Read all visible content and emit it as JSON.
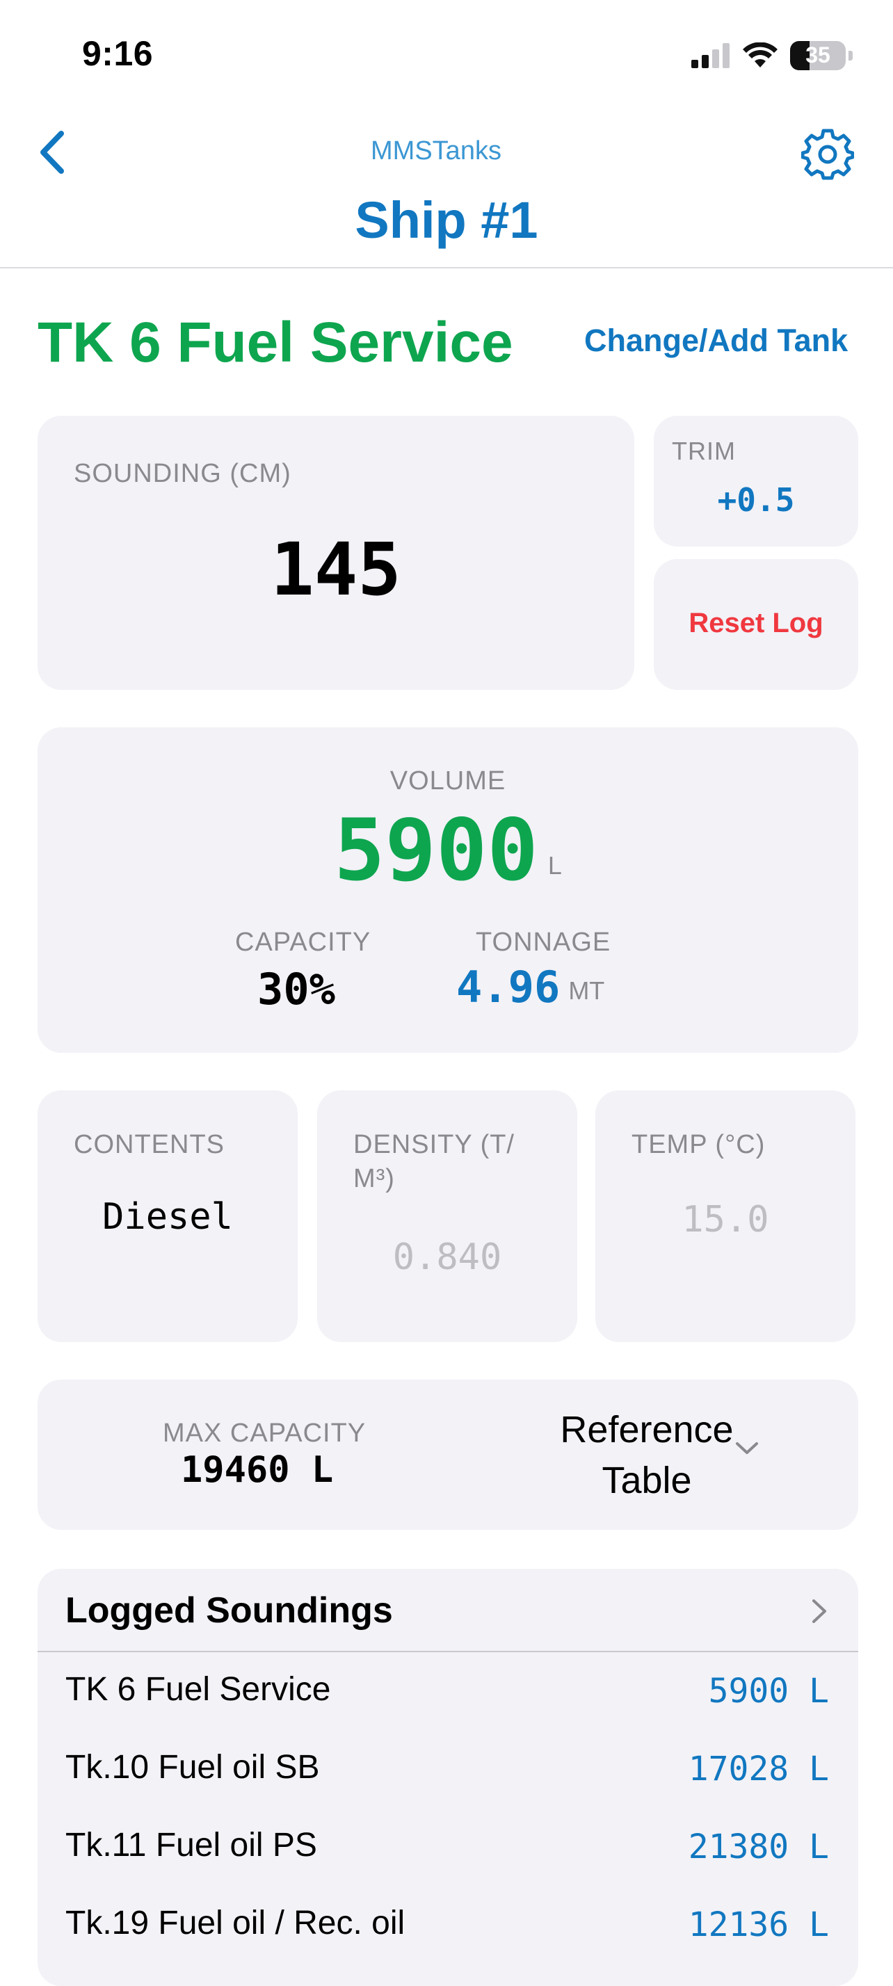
{
  "status_bar": {
    "time": "9:16",
    "battery_level": "35",
    "battery_fraction": 0.35,
    "icons": [
      "signal-icon",
      "wifi-icon",
      "battery-icon"
    ]
  },
  "nav": {
    "app_name": "MMSTanks",
    "title": "Ship #1",
    "back_icon": "chevron-left-icon",
    "settings_icon": "gear-icon"
  },
  "tank": {
    "name": "TK 6 Fuel Service",
    "change_label": "Change/Add Tank"
  },
  "sounding": {
    "label": "SOUNDING (CM)",
    "value": "145"
  },
  "trim": {
    "label": "TRIM",
    "value": "+0.5"
  },
  "reset_label": "Reset Log",
  "volume": {
    "label": "VOLUME",
    "value": "5900",
    "unit": "L",
    "capacity_label": "CAPACITY",
    "capacity_value": "30%",
    "tonnage_label": "TONNAGE",
    "tonnage_value": "4.96",
    "tonnage_unit": "MT"
  },
  "contents": {
    "label": "CONTENTS",
    "value": "Diesel"
  },
  "density": {
    "label": "DENSITY (T/ M³)",
    "placeholder": "0.840"
  },
  "temp": {
    "label": "TEMP (°C)",
    "placeholder": "15.0"
  },
  "max_capacity": {
    "label": "MAX CAPACITY",
    "value": "19460 L"
  },
  "reference_table": {
    "label": "Reference Table"
  },
  "logged": {
    "title": "Logged Soundings",
    "rows": [
      {
        "name": "TK 6 Fuel Service",
        "value": "5900 L"
      },
      {
        "name": "Tk.10 Fuel oil SB",
        "value": "17028 L"
      },
      {
        "name": "Tk.11 Fuel oil PS",
        "value": "21380 L"
      },
      {
        "name": "Tk.19 Fuel oil / Rec. oil",
        "value": "12136 L"
      }
    ]
  },
  "colors": {
    "accent_blue": "#1177c0",
    "accent_green": "#0ea54f",
    "danger_red": "#f0383f",
    "card_bg": "#f2f2f7"
  }
}
